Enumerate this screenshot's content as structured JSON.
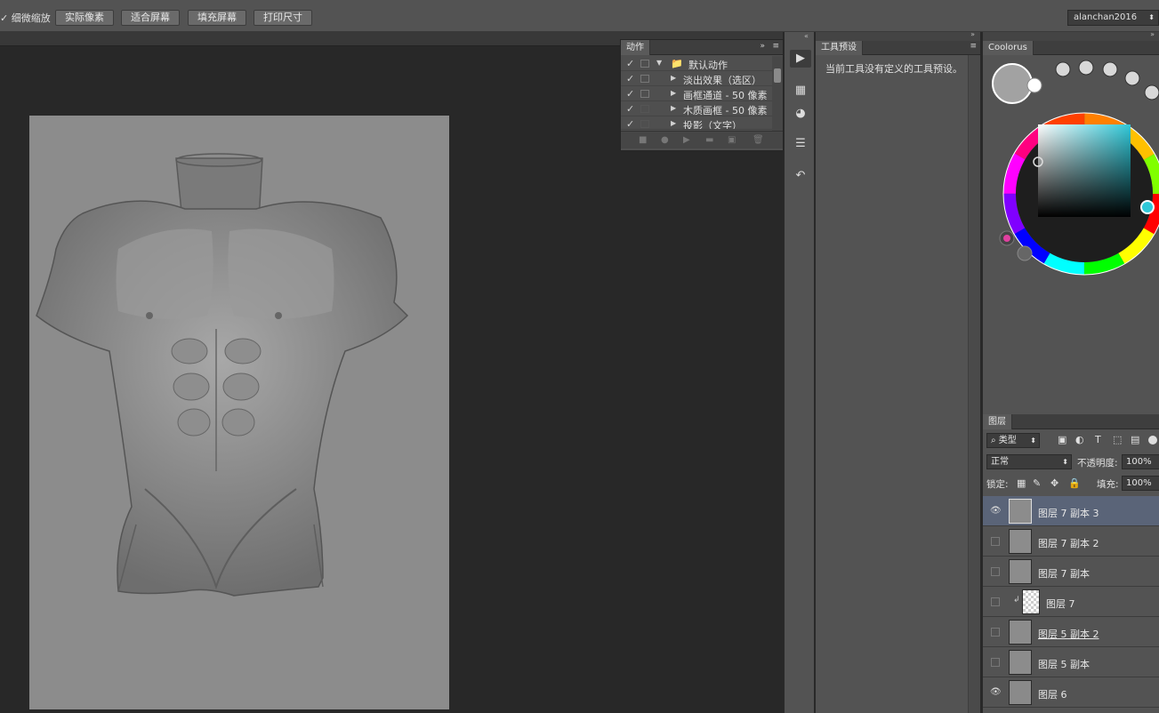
{
  "options_bar": {
    "scrubby_zoom_label": "细微缩放",
    "buttons": [
      "实际像素",
      "适合屏幕",
      "填充屏幕",
      "打印尺寸"
    ],
    "workspace": "alanchan2016"
  },
  "actions_panel": {
    "tab": "动作",
    "rows": [
      {
        "label": "默认动作",
        "type": "set"
      },
      {
        "label": "淡出效果（选区）",
        "type": "action"
      },
      {
        "label": "画框通道 - 50 像素",
        "type": "action"
      },
      {
        "label": "木质画框 - 50 像素",
        "type": "action"
      },
      {
        "label": "投影（文字）",
        "type": "action"
      }
    ]
  },
  "tool_presets_panel": {
    "tab": "工具预设",
    "message": "当前工具没有定义的工具预设。"
  },
  "coolorus_panel": {
    "tab": "Coolorus",
    "current_color": "#a2a2a2",
    "hue_color": "#30c8d8"
  },
  "layers_panel": {
    "tab": "图层",
    "filter_label": "类型",
    "blend_mode": "正常",
    "opacity_label": "不透明度:",
    "opacity_value": "100%",
    "lock_label": "锁定:",
    "fill_label": "填充:",
    "fill_value": "100%",
    "layers": [
      {
        "name": "图层 7 副本 3",
        "visible": true,
        "selected": true
      },
      {
        "name": "图层 7 副本 2",
        "visible": false,
        "selected": false
      },
      {
        "name": "图层 7 副本",
        "visible": false,
        "selected": false
      },
      {
        "name": "图层 7",
        "visible": false,
        "selected": false,
        "clipped": true
      },
      {
        "name": "图层 5 副本 2",
        "visible": false,
        "selected": false
      },
      {
        "name": "图层 5 副本",
        "visible": false,
        "selected": false
      },
      {
        "name": "图层 6",
        "visible": true,
        "selected": false
      }
    ]
  }
}
